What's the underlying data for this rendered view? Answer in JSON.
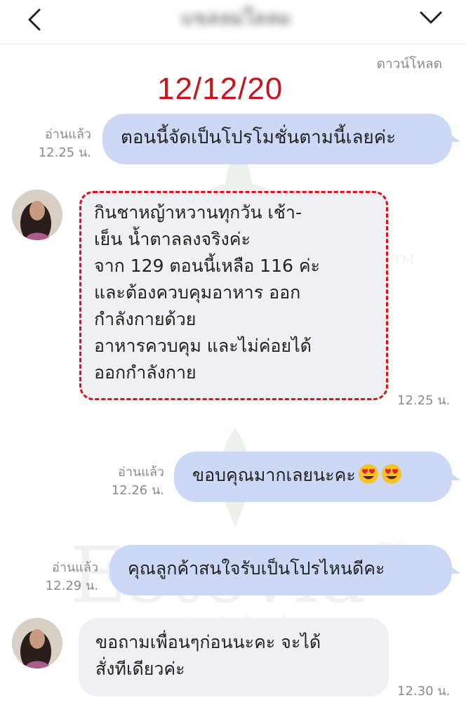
{
  "header": {
    "title": "แขลลม่ใลลม"
  },
  "watermark": {
    "brand": "Estevia",
    "tm": "TM",
    "url": "www.estevia-herb.com"
  },
  "download_label": "ดาวน์โหลด",
  "date_stamp": "12/12/20",
  "messages": [
    {
      "direction": "outgoing",
      "text": "ตอนนี้จัดเป็นโปรโมชั่นตามนี้เลยค่ะ",
      "read": "อ่านแล้ว",
      "time": "12.25 น."
    },
    {
      "direction": "incoming",
      "lines": [
        "กินชาหญ้าหวานทุกวัน เช้า-",
        "เย็น น้ำตาลลงจริงค่ะ",
        "จาก 129 ตอนนี้เหลือ 116 ค่ะ",
        "และต้องควบคุมอาหาร ออก",
        "กำลังกายด้วย",
        "อาหารควบคุม และไม่ค่อยได้",
        "ออกกำลังกาย"
      ],
      "time": "12.25 น."
    },
    {
      "direction": "outgoing",
      "text": "ขอบคุณมากเลยนะคะ",
      "emoji": "heart-eyes-emoji",
      "read": "อ่านแล้ว",
      "time": "12.26 น."
    },
    {
      "direction": "outgoing",
      "text": "คุณลูกค้าสนใจรับเป็นโปรไหนดีคะ",
      "read": "อ่านแล้ว",
      "time": "12.29 น."
    },
    {
      "direction": "incoming",
      "lines": [
        "ขอถามเพื่อนๆก่อนนะคะ จะได้",
        "สั่งทีเดียวค่ะ"
      ],
      "time": "12.30 น."
    }
  ],
  "colors": {
    "outgoing_bubble": "#cdd7f6",
    "incoming_bubble": "#eef0f3",
    "date_stamp": "#c8141e",
    "highlight_border": "#e2101a"
  },
  "icons": {
    "back": "chevron-left-icon",
    "menu": "chevron-down-icon"
  }
}
